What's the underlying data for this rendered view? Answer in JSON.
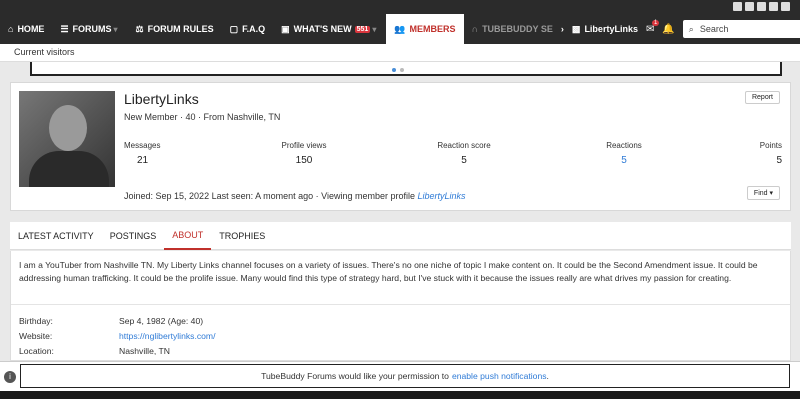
{
  "social": {
    "icons": [
      "facebook-icon",
      "discord-icon",
      "instagram-icon",
      "twitter-icon",
      "youtube-icon"
    ]
  },
  "nav": {
    "items": [
      {
        "glyph": "⌂",
        "label": "HOME",
        "name": "home"
      },
      {
        "glyph": "☰",
        "label": "FORUMS",
        "name": "forums"
      },
      {
        "glyph": "⚖",
        "label": "FORUM RULES",
        "name": "forum-rules"
      },
      {
        "glyph": "?",
        "label": "F.A.Q",
        "name": "faq"
      },
      {
        "glyph": "✎",
        "label": "WHAT'S NEW",
        "name": "whats-new",
        "badge": "551"
      },
      {
        "glyph": "☺",
        "label": "MEMBERS",
        "name": "members",
        "active": true
      },
      {
        "glyph": "🎧",
        "label": "TUBEBUDDY SE",
        "name": "tubebuddy"
      }
    ],
    "user": "LibertyLinks",
    "mail_count": "1",
    "search_placeholder": "Search"
  },
  "subnav": {
    "label": "Current visitors"
  },
  "profile": {
    "username": "LibertyLinks",
    "meta": "New Member · 40 · From Nashville, TN",
    "report_label": "Report",
    "stats": [
      {
        "label": "Messages",
        "value": "21"
      },
      {
        "label": "Profile views",
        "value": "150"
      },
      {
        "label": "Reaction score",
        "value": "5"
      },
      {
        "label": "Reactions",
        "value": "5",
        "link": true
      },
      {
        "label": "Points",
        "value": "5"
      }
    ],
    "joined_prefix": "Joined: Sep 15, 2022   Last seen: A moment ago · Viewing member profile",
    "joined_link": "LibertyLinks",
    "find_label": "Find ▾"
  },
  "tabs": [
    "LATEST ACTIVITY",
    "POSTINGS",
    "ABOUT",
    "TROPHIES"
  ],
  "active_tab": "ABOUT",
  "about": {
    "bio": "I am a YouTuber from Nashville TN. My Liberty Links channel focuses on a variety of issues. There's no one niche of topic I make content on. It could be the Second Amendment issue. It could be addressing human trafficking. It could be the prolife issue. Many would find this type of strategy hard, but I've stuck with it because the issues really are what drives my passion for creating.",
    "birthday_label": "Birthday:",
    "birthday": "Sep 4, 1982 (Age: 40)",
    "website_label": "Website:",
    "website": "https://nglibertylinks.com/",
    "location_label": "Location:",
    "location": "Nashville, TN"
  },
  "push": {
    "text": "TubeBuddy Forums would like your permission to",
    "link": "enable push notifications",
    "tail": "."
  }
}
